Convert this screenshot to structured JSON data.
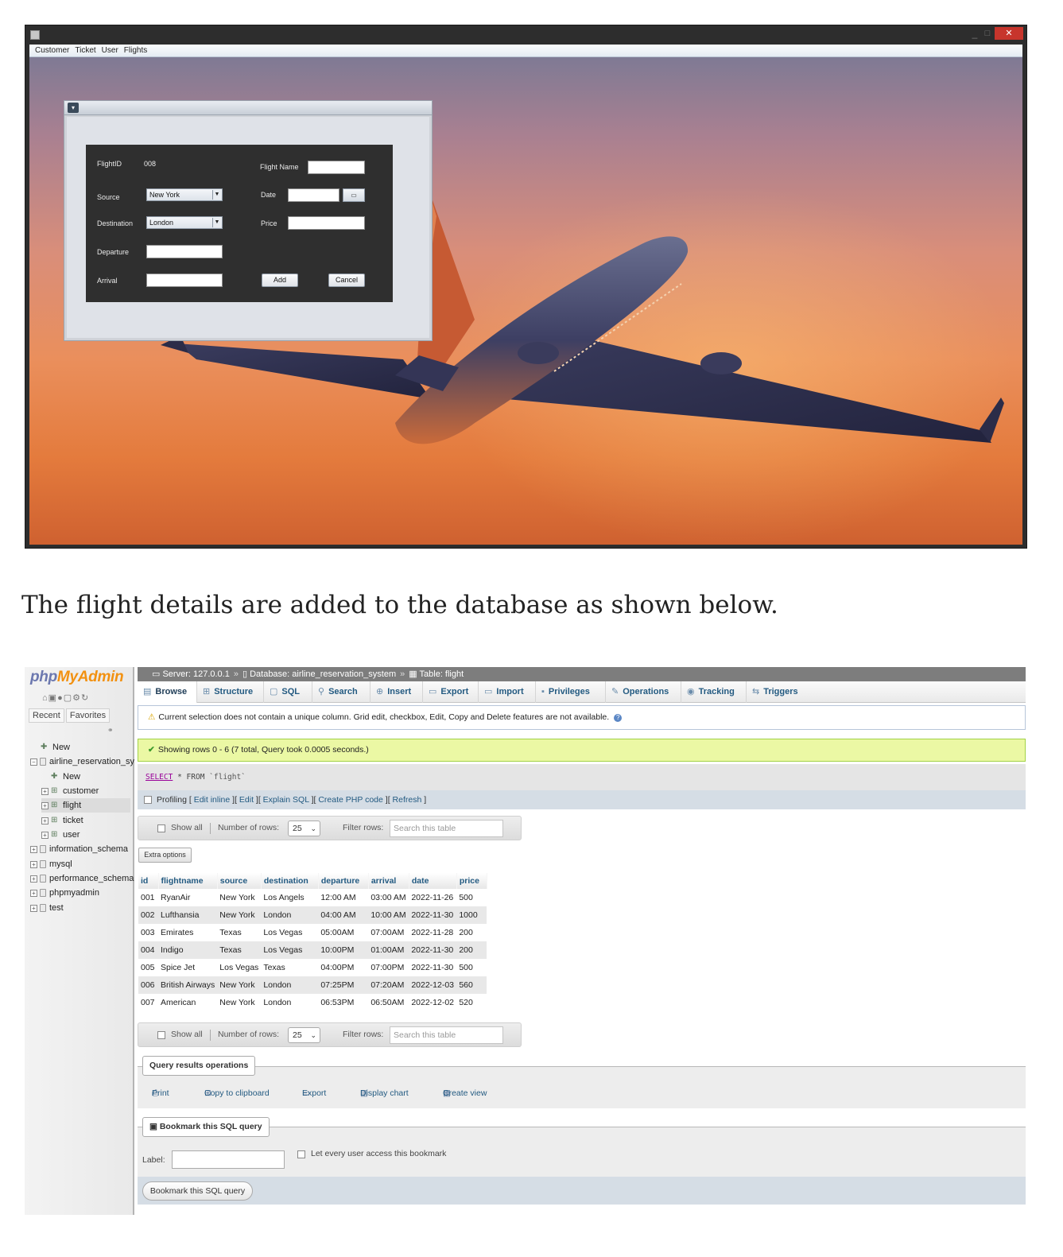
{
  "java_app": {
    "menu": [
      "Customer",
      "Ticket",
      "User",
      "Flights"
    ],
    "window_controls": {
      "minimize": "_",
      "maximize": "□",
      "close": "✕"
    },
    "form": {
      "flightid_label": "FlightID",
      "flightid_value": "008",
      "flightname_label": "Flight Name",
      "flightname_value": "",
      "source_label": "Source",
      "source_value": "New York",
      "date_label": "Date",
      "date_value": "",
      "destination_label": "Destination",
      "destination_value": "London",
      "price_label": "Price",
      "price_value": "",
      "departure_label": "Departure",
      "departure_value": "",
      "arrival_label": "Arrival",
      "arrival_value": "",
      "add_button": "Add",
      "cancel_button": "Cancel"
    }
  },
  "caption": "The flight details are added to the database as shown below.",
  "pma": {
    "logo_php": "php",
    "logo_my": "MyAdmin",
    "sidebar_tabs": [
      "Recent",
      "Favorites"
    ],
    "tree": [
      {
        "label": "New",
        "kind": "new"
      },
      {
        "label": "airline_reservation_sy",
        "kind": "db-open"
      },
      {
        "label": "New",
        "kind": "new-child"
      },
      {
        "label": "customer",
        "kind": "table"
      },
      {
        "label": "flight",
        "kind": "table-selected"
      },
      {
        "label": "ticket",
        "kind": "table"
      },
      {
        "label": "user",
        "kind": "table"
      },
      {
        "label": "information_schema",
        "kind": "db"
      },
      {
        "label": "mysql",
        "kind": "db"
      },
      {
        "label": "performance_schema",
        "kind": "db"
      },
      {
        "label": "phpmyadmin",
        "kind": "db"
      },
      {
        "label": "test",
        "kind": "db"
      }
    ],
    "breadcrumb": {
      "server": "Server: 127.0.0.1",
      "database": "Database: airline_reservation_system",
      "table": "Table: flight",
      "separator": "»"
    },
    "tabs": [
      "Browse",
      "Structure",
      "SQL",
      "Search",
      "Insert",
      "Export",
      "Import",
      "Privileges",
      "Operations",
      "Tracking",
      "Triggers"
    ],
    "warning": "Current selection does not contain a unique column. Grid edit, checkbox, Edit, Copy and Delete features are not available.",
    "success": "Showing rows 0 - 6 (7 total, Query took 0.0005 seconds.)",
    "sql": {
      "select": "SELECT",
      "star": "*",
      "from": "FROM",
      "table": "`flight`"
    },
    "profiling": {
      "label": "Profiling",
      "links": [
        "Edit inline",
        "Edit",
        "Explain SQL",
        "Create PHP code",
        "Refresh"
      ]
    },
    "nav": {
      "show_all": "Show all",
      "rows_label": "Number of rows:",
      "rows_value": "25",
      "filter_label": "Filter rows:",
      "filter_placeholder": "Search this table"
    },
    "extra_options": "Extra options",
    "columns": [
      "id",
      "flightname",
      "source",
      "destination",
      "departure",
      "arrival",
      "date",
      "price"
    ],
    "rows": [
      [
        "001",
        "RyanAir",
        "New York",
        "Los Angels",
        "12:00 AM",
        "03:00 AM",
        "2022-11-26",
        "500"
      ],
      [
        "002",
        "Lufthansia",
        "New York",
        "London",
        "04:00 AM",
        "10:00 AM",
        "2022-11-30",
        "1000"
      ],
      [
        "003",
        "Emirates",
        "Texas",
        "Los Vegas",
        "05:00AM",
        "07:00AM",
        "2022-11-28",
        "200"
      ],
      [
        "004",
        "Indigo",
        "Texas",
        "Los Vegas",
        "10:00PM",
        "01:00AM",
        "2022-11-30",
        "200"
      ],
      [
        "005",
        "Spice Jet",
        "Los Vegas",
        "Texas",
        "04:00PM",
        "07:00PM",
        "2022-11-30",
        "500"
      ],
      [
        "006",
        "British Airways",
        "New York",
        "London",
        "07:25PM",
        "07:20AM",
        "2022-12-03",
        "560"
      ],
      [
        "007",
        "American",
        "New York",
        "London",
        "06:53PM",
        "06:50AM",
        "2022-12-02",
        "520"
      ]
    ],
    "query_ops": {
      "legend": "Query results operations",
      "items": [
        "Print",
        "Copy to clipboard",
        "Export",
        "Display chart",
        "Create view"
      ]
    },
    "bookmark": {
      "legend": "Bookmark this SQL query",
      "label": "Label:",
      "checkbox_label": "Let every user access this bookmark",
      "button": "Bookmark this SQL query"
    }
  }
}
